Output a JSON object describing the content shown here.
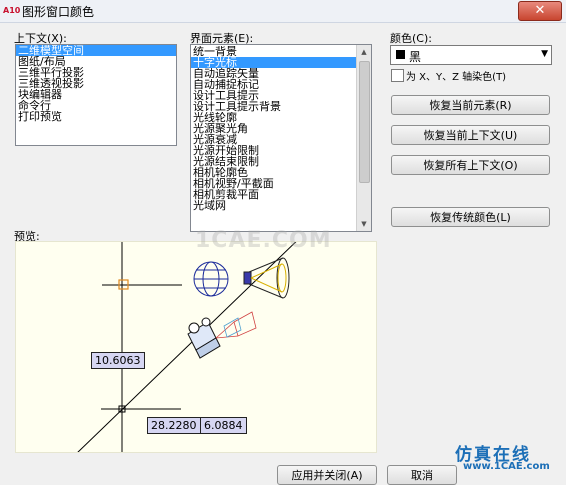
{
  "window": {
    "title": "图形窗口颜色",
    "close": "✕"
  },
  "context": {
    "label": "上下文(X):",
    "items": [
      {
        "label": "二维模型空间",
        "selected": true
      },
      {
        "label": "图纸/布局",
        "selected": false
      },
      {
        "label": "三维平行投影",
        "selected": false
      },
      {
        "label": "三维透视投影",
        "selected": false
      },
      {
        "label": "块编辑器",
        "selected": false
      },
      {
        "label": "命令行",
        "selected": false
      },
      {
        "label": "打印预览",
        "selected": false
      }
    ]
  },
  "elements": {
    "label": "界面元素(E):",
    "items": [
      {
        "label": "统一背景",
        "selected": false
      },
      {
        "label": "十字光标",
        "selected": true
      },
      {
        "label": "自动追踪矢量",
        "selected": false
      },
      {
        "label": "自动捕捉标记",
        "selected": false
      },
      {
        "label": "设计工具提示",
        "selected": false
      },
      {
        "label": "设计工具提示背景",
        "selected": false
      },
      {
        "label": "光线轮廓",
        "selected": false
      },
      {
        "label": "光源聚光角",
        "selected": false
      },
      {
        "label": "光源衰减",
        "selected": false
      },
      {
        "label": "光源开始限制",
        "selected": false
      },
      {
        "label": "光源结束限制",
        "selected": false
      },
      {
        "label": "相机轮廓色",
        "selected": false
      },
      {
        "label": "相机视野/平截面",
        "selected": false
      },
      {
        "label": "相机剪裁平面",
        "selected": false
      },
      {
        "label": "光域网",
        "selected": false
      }
    ]
  },
  "color": {
    "label": "颜色(C):",
    "value": "黑",
    "swatch": "#000000",
    "tint_checkbox": "为 X、Y、Z 轴染色(T)"
  },
  "buttons": {
    "restore_element": "恢复当前元素(R)",
    "restore_context": "恢复当前上下文(U)",
    "restore_all": "恢复所有上下文(O)",
    "restore_classic": "恢复传统颜色(L)",
    "apply_close": "应用并关闭(A)",
    "cancel": "取消"
  },
  "preview": {
    "label": "预览:",
    "readout1": "10.6063",
    "readout2": "28.2280",
    "readout3": "6.0884"
  },
  "watermark": {
    "text": "1CAE.COM",
    "brand": "仿真在线",
    "url": "www.1CAE.com"
  }
}
